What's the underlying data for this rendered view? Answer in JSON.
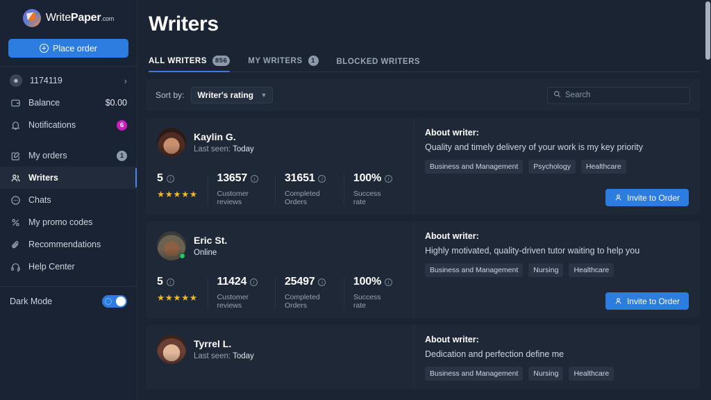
{
  "brand": {
    "name_part1": "Write",
    "name_part2": "Paper",
    "suffix": ".com",
    "logo_icon": "pencil-circle-logo"
  },
  "sidebar": {
    "place_order_label": "Place order",
    "place_order_icon": "plus-circle-icon",
    "account": {
      "id": "1174119",
      "icon": "person-icon",
      "chevron": "›"
    },
    "balance": {
      "label": "Balance",
      "value": "$0.00",
      "icon": "wallet-icon"
    },
    "notifications": {
      "label": "Notifications",
      "count": "6",
      "icon": "bell-icon"
    },
    "items": [
      {
        "label": "My orders",
        "icon": "edit-square-icon",
        "badge": "1",
        "active": false
      },
      {
        "label": "Writers",
        "icon": "writers-icon",
        "badge": "",
        "active": true
      },
      {
        "label": "Chats",
        "icon": "chat-icon",
        "badge": "",
        "active": false
      },
      {
        "label": "My promo codes",
        "icon": "percent-icon",
        "badge": "",
        "active": false
      },
      {
        "label": "Recommendations",
        "icon": "paperclip-icon",
        "badge": "",
        "active": false
      },
      {
        "label": "Help Center",
        "icon": "headset-icon",
        "badge": "",
        "active": false
      }
    ],
    "dark_mode": {
      "label": "Dark Mode",
      "state": "on",
      "icon": "sun-icon"
    }
  },
  "header": {
    "title": "Writers"
  },
  "tabs": [
    {
      "label": "ALL WRITERS",
      "count": "856",
      "active": true
    },
    {
      "label": "MY WRITERS",
      "count": "1",
      "active": false
    },
    {
      "label": "BLOCKED WRITERS",
      "count": "",
      "active": false
    }
  ],
  "toolbar": {
    "sort_label": "Sort by:",
    "sort_value": "Writer's rating",
    "sort_caret_icon": "chevron-down-icon",
    "search_placeholder": "Search",
    "search_value": "",
    "search_icon": "search-icon"
  },
  "stat_captions": {
    "rating": "",
    "reviews": "Customer reviews",
    "orders": "Completed Orders",
    "success": "Success rate"
  },
  "about_label": "About writer:",
  "invite_label": "Invite to Order",
  "invite_icon": "person-add-icon",
  "writers": [
    {
      "name": "Kaylin G.",
      "status_prefix": "Last seen:",
      "status_value": "Today",
      "online": false,
      "avatar": "kaylin-avatar",
      "rating": "5",
      "stars": "★★★★★",
      "reviews": "13657",
      "orders": "31651",
      "success": "100%",
      "about": "Quality and timely delivery of your work is my key priority",
      "tags": [
        "Business and Management",
        "Psychology",
        "Healthcare"
      ],
      "has_invite": true
    },
    {
      "name": "Eric St.",
      "status_prefix": "",
      "status_value": "Online",
      "online": true,
      "avatar": "eric-avatar",
      "rating": "5",
      "stars": "★★★★★",
      "reviews": "11424",
      "orders": "25497",
      "success": "100%",
      "about": "Highly motivated, quality-driven tutor waiting to help you",
      "tags": [
        "Business and Management",
        "Nursing",
        "Healthcare"
      ],
      "has_invite": true
    },
    {
      "name": "Tyrrel L.",
      "status_prefix": "Last seen:",
      "status_value": "Today",
      "online": false,
      "avatar": "tyrrel-avatar",
      "rating": "",
      "stars": "",
      "reviews": "",
      "orders": "",
      "success": "",
      "about": "Dedication and perfection define me",
      "tags": [
        "Business and Management",
        "Nursing",
        "Healthcare"
      ],
      "has_invite": false
    }
  ],
  "colors": {
    "accent": "#2d7ce0",
    "tab_underline": "#3b7ddd",
    "notification_badge": "#cc1fbf",
    "star": "#f5b623",
    "online": "#22c55e",
    "sidebar_bg": "#1a2333",
    "main_bg": "#1b2433",
    "card_bg": "#1e2836"
  }
}
